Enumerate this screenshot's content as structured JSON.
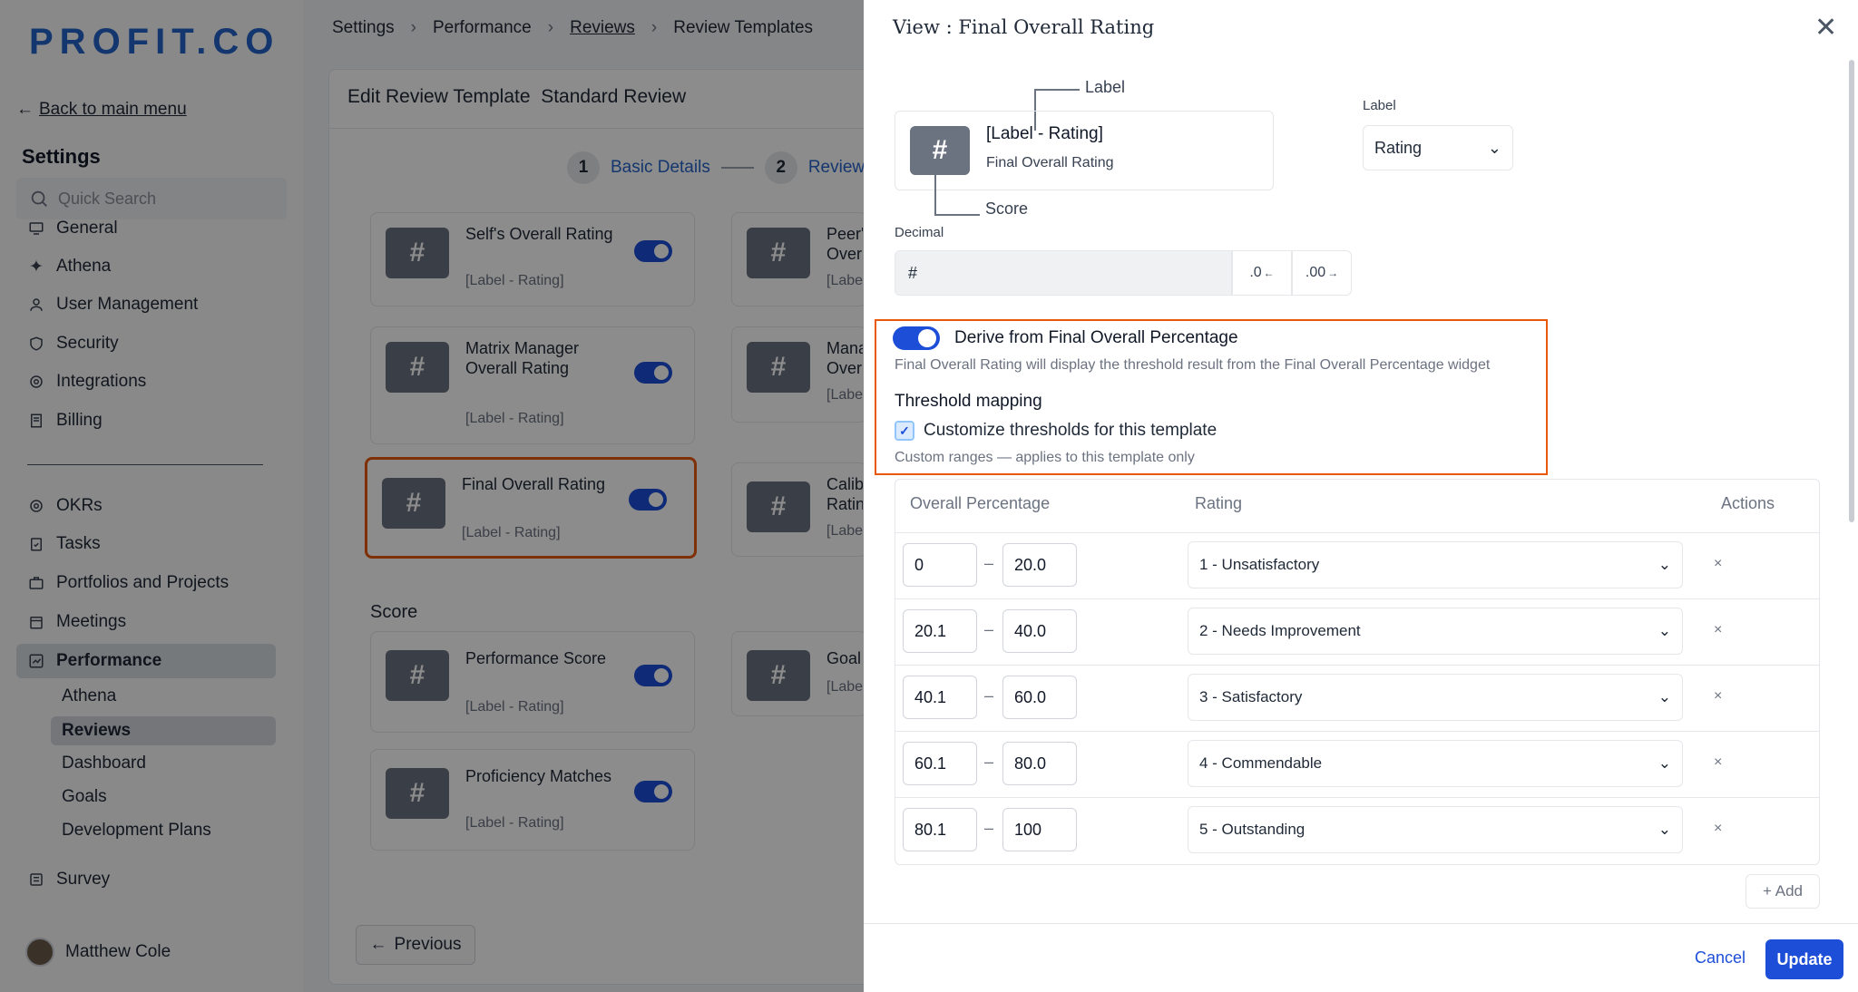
{
  "brand": {
    "logo": "PROFIT.CO",
    "accent": "#1d4ed8",
    "highlight": "#ea580c"
  },
  "sidebar": {
    "back": "Back to main menu",
    "title": "Settings",
    "search_placeholder": "Quick Search",
    "settings_items": [
      {
        "label": "General",
        "icon": "monitor-icon"
      },
      {
        "label": "Athena",
        "icon": "sparkle-icon"
      },
      {
        "label": "User Management",
        "icon": "user-icon"
      },
      {
        "label": "Security",
        "icon": "shield-icon"
      },
      {
        "label": "Integrations",
        "icon": "gear-icon"
      },
      {
        "label": "Billing",
        "icon": "receipt-icon"
      }
    ],
    "modules": [
      {
        "label": "OKRs",
        "icon": "target-icon"
      },
      {
        "label": "Tasks",
        "icon": "clipboard-icon"
      },
      {
        "label": "Portfolios and Projects",
        "icon": "briefcase-icon"
      },
      {
        "label": "Meetings",
        "icon": "calendar-icon"
      },
      {
        "label": "Performance",
        "icon": "chart-icon"
      }
    ],
    "performance_sub": [
      "Athena",
      "Reviews",
      "Dashboard",
      "Goals",
      "Development Plans"
    ],
    "survey": {
      "label": "Survey",
      "icon": "survey-icon"
    },
    "user": "Matthew Cole"
  },
  "main": {
    "breadcrumb": [
      "Settings",
      "Performance",
      "Reviews",
      "Review Templates"
    ],
    "title": "Edit Review Template",
    "template_name": "Standard Review",
    "steps": [
      {
        "num": "1",
        "label": "Basic Details"
      },
      {
        "num": "2",
        "label": "Review"
      }
    ],
    "widgets": [
      {
        "name": "Self's Overall Rating",
        "sub": "[Label - Rating]"
      },
      {
        "name": "Matrix Manager Overall Rating",
        "sub": "[Label - Rating]"
      },
      {
        "name": "Final Overall Rating",
        "sub": "[Label - Rating]"
      }
    ],
    "right_widgets": [
      {
        "name": "Peer's Over",
        "sub": "[Labe"
      },
      {
        "name": "Mana Over",
        "sub": "[Labe"
      },
      {
        "name": "Calib Ratin",
        "sub": "[Labe"
      },
      {
        "name": "Goal",
        "sub": "[Labe"
      }
    ],
    "score_section": "Score",
    "score_widgets": [
      {
        "name": "Performance Score",
        "sub": "[Label - Rating]"
      },
      {
        "name": "Proficiency Matches",
        "sub": "[Label - Rating]"
      }
    ],
    "previous": "Previous"
  },
  "drawer": {
    "title": "View : Final Overall Rating",
    "preview": {
      "label_callout": "Label",
      "score_callout": "Score",
      "hash": "#",
      "name": "[Label - Rating]",
      "sub": "Final Overall Rating"
    },
    "label_field": {
      "caption": "Label",
      "value": "Rating"
    },
    "decimal": {
      "caption": "Decimal",
      "value": "#",
      "dec_less": ".0",
      "dec_more": ".00"
    },
    "derive": {
      "label": "Derive from Final Overall Percentage",
      "help": "Final Overall Rating will display the threshold result from the Final Overall Percentage widget",
      "enabled": true
    },
    "threshold": {
      "title": "Threshold mapping",
      "customize_label": "Customize thresholds for this template",
      "customize_checked": true,
      "help": "Custom ranges — applies to this template only",
      "headers": [
        "Overall Percentage",
        "Rating",
        "Actions"
      ],
      "rows": [
        {
          "from": "0",
          "to": "20.0",
          "rating": "1 - Unsatisfactory"
        },
        {
          "from": "20.1",
          "to": "40.0",
          "rating": "2 - Needs Improvement"
        },
        {
          "from": "40.1",
          "to": "60.0",
          "rating": "3 - Satisfactory"
        },
        {
          "from": "60.1",
          "to": "80.0",
          "rating": "4 - Commendable"
        },
        {
          "from": "80.1",
          "to": "100",
          "rating": "5 - Outstanding"
        }
      ],
      "add": "+ Add"
    },
    "cancel": "Cancel",
    "update": "Update"
  }
}
